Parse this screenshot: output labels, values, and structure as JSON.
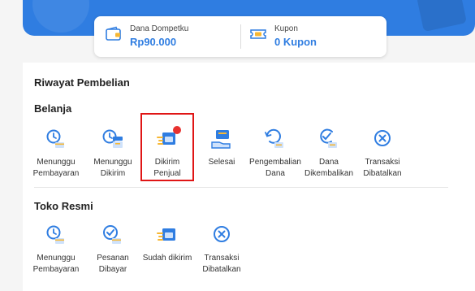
{
  "colors": {
    "accent": "#2f7de1",
    "highlight": "#e01515",
    "badge": "#e8322f"
  },
  "wallet": {
    "dompet": {
      "label": "Dana Dompetku",
      "value": "Rp90.000",
      "icon": "wallet-icon"
    },
    "kupon": {
      "label": "Kupon",
      "value": "0 Kupon",
      "icon": "ticket-icon"
    }
  },
  "page_title": "Riwayat Pembelian",
  "belanja": {
    "title": "Belanja",
    "items": [
      {
        "label_1": "Menunggu",
        "label_2": "Pembayaran",
        "icon": "clock-card-icon"
      },
      {
        "label_1": "Menunggu",
        "label_2": "Dikirim",
        "icon": "clock-box-icon"
      },
      {
        "label_1": "Dikirim",
        "label_2": "Penjual",
        "icon": "truck-icon",
        "badge": true
      },
      {
        "label_1": "Selesai",
        "label_2": "",
        "icon": "hand-box-icon"
      },
      {
        "label_1": "Pengembalian",
        "label_2": "Dana",
        "icon": "refund-icon"
      },
      {
        "label_1": "Dana",
        "label_2": "Dikembalikan",
        "icon": "check-refund-icon"
      },
      {
        "label_1": "Transaksi",
        "label_2": "Dibatalkan",
        "icon": "cancel-icon"
      }
    ]
  },
  "toko_resmi": {
    "title": "Toko Resmi",
    "items": [
      {
        "label_1": "Menunggu",
        "label_2": "Pembayaran",
        "icon": "clock-card-icon"
      },
      {
        "label_1": "Pesanan",
        "label_2": "Dibayar",
        "icon": "check-card-icon"
      },
      {
        "label_1": "Sudah dikirim",
        "label_2": "",
        "icon": "truck-icon"
      },
      {
        "label_1": "Transaksi",
        "label_2": "Dibatalkan",
        "icon": "cancel-icon"
      }
    ]
  }
}
